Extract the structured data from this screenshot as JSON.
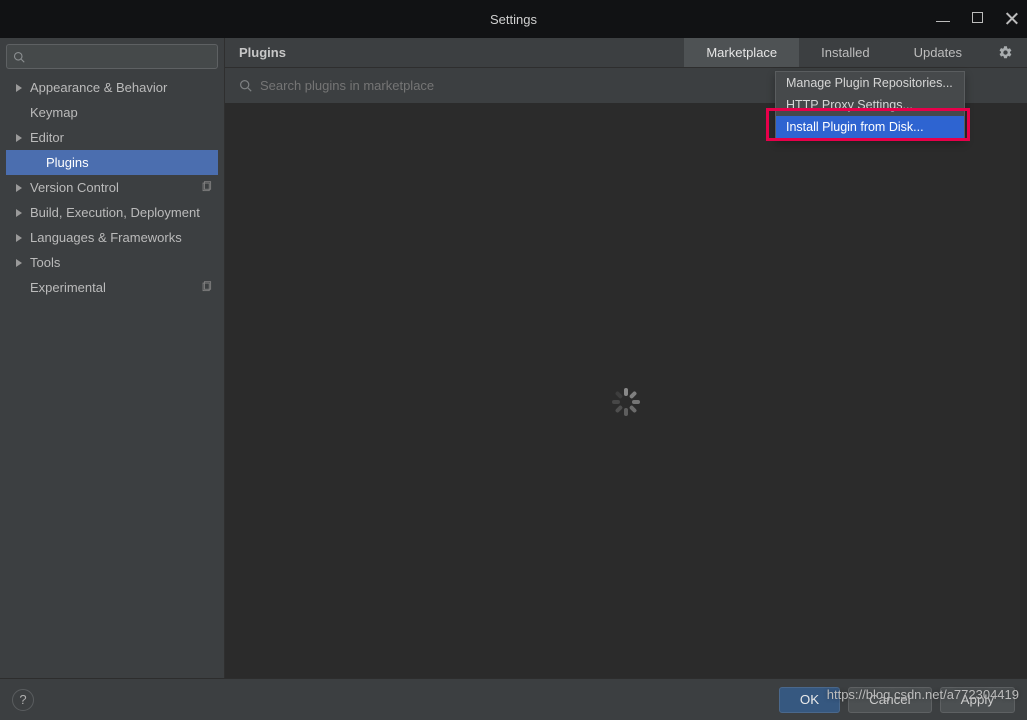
{
  "window": {
    "title": "Settings"
  },
  "sidebar": {
    "items": [
      {
        "label": "Appearance & Behavior",
        "expandable": true
      },
      {
        "label": "Keymap",
        "expandable": false
      },
      {
        "label": "Editor",
        "expandable": true
      },
      {
        "label": "Plugins",
        "expandable": false,
        "child": true,
        "selected": true
      },
      {
        "label": "Version Control",
        "expandable": true,
        "badge": "copy"
      },
      {
        "label": "Build, Execution, Deployment",
        "expandable": true
      },
      {
        "label": "Languages & Frameworks",
        "expandable": true
      },
      {
        "label": "Tools",
        "expandable": true
      },
      {
        "label": "Experimental",
        "expandable": false,
        "badge": "copy"
      }
    ]
  },
  "main": {
    "title": "Plugins",
    "tabs": [
      {
        "label": "Marketplace",
        "active": true
      },
      {
        "label": "Installed"
      },
      {
        "label": "Updates"
      }
    ],
    "searchPlaceholder": "Search plugins in marketplace"
  },
  "gearMenu": {
    "items": [
      {
        "label": "Manage Plugin Repositories..."
      },
      {
        "label": "HTTP Proxy Settings..."
      },
      {
        "label": "Install Plugin from Disk...",
        "highlighted": true
      }
    ]
  },
  "footer": {
    "help": "?",
    "ok": "OK",
    "cancel": "Cancel",
    "apply": "Apply"
  },
  "watermark": "https://blog.csdn.net/a772304419"
}
